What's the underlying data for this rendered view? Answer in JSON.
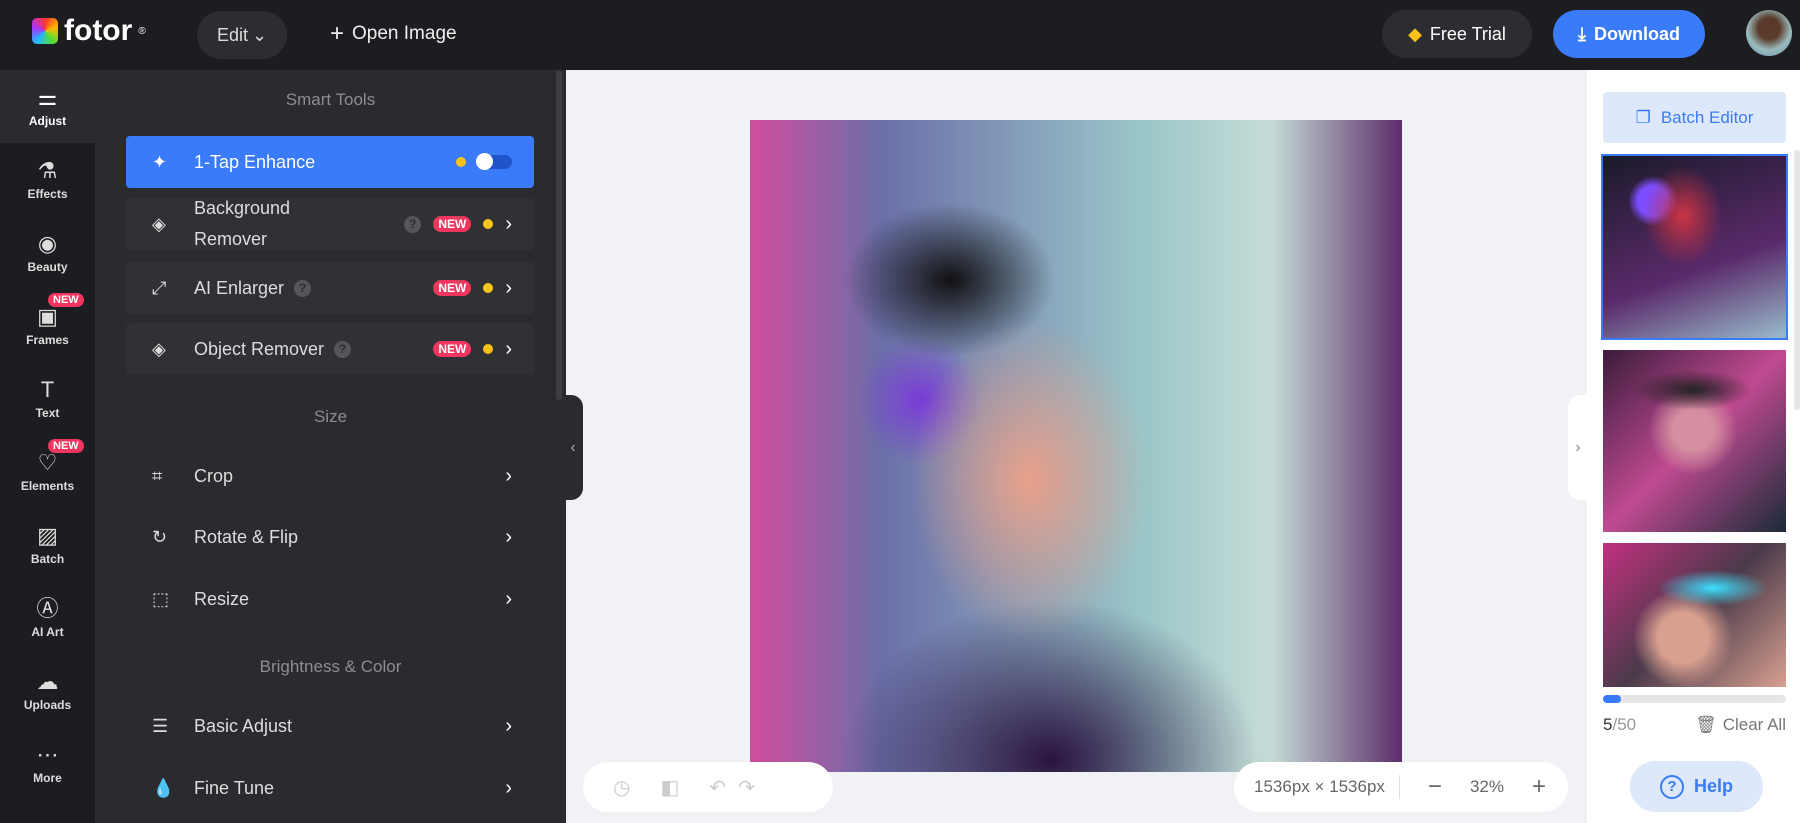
{
  "header": {
    "logo": "fotor",
    "edit_label": "Edit",
    "open_image_label": "Open Image",
    "free_trial_label": "Free Trial",
    "download_label": "Download"
  },
  "rail": [
    {
      "label": "Adjust",
      "icon": "sliders-icon",
      "glyph": "⚌",
      "active": true
    },
    {
      "label": "Effects",
      "icon": "flask-icon",
      "glyph": "⚗"
    },
    {
      "label": "Beauty",
      "icon": "eye-icon",
      "glyph": "◉"
    },
    {
      "label": "Frames",
      "icon": "frame-icon",
      "glyph": "▣",
      "badge": "NEW"
    },
    {
      "label": "Text",
      "icon": "text-icon",
      "glyph": "T"
    },
    {
      "label": "Elements",
      "icon": "shapes-icon",
      "glyph": "♡",
      "badge": "NEW"
    },
    {
      "label": "Batch",
      "icon": "batch-icon",
      "glyph": "▨"
    },
    {
      "label": "AI Art",
      "icon": "ai-icon",
      "glyph": "Ⓐ"
    },
    {
      "label": "Uploads",
      "icon": "upload-icon",
      "glyph": "☁"
    },
    {
      "label": "More",
      "icon": "more-icon",
      "glyph": "⋯"
    }
  ],
  "panel": {
    "sections": [
      "Smart Tools",
      "Size",
      "Brightness & Color"
    ],
    "tools": [
      {
        "label": "1-Tap Enhance",
        "glyph": "✦"
      },
      {
        "label": "Background Remover",
        "glyph": "◈",
        "badge": "NEW"
      },
      {
        "label": "AI Enlarger",
        "glyph": "⤢",
        "badge": "NEW"
      },
      {
        "label": "Object Remover",
        "glyph": "◈",
        "badge": "NEW"
      },
      {
        "label": "Crop",
        "glyph": "⌗"
      },
      {
        "label": "Rotate & Flip",
        "glyph": "↻"
      },
      {
        "label": "Resize",
        "glyph": "⬚"
      },
      {
        "label": "Basic Adjust",
        "glyph": "☰"
      },
      {
        "label": "Fine Tune",
        "glyph": "💧"
      }
    ]
  },
  "canvas": {
    "dimensions": "1536px × 1536px",
    "zoom": "32%"
  },
  "right_panel": {
    "batch_editor_label": "Batch Editor",
    "count_current": "5",
    "count_total": "/50",
    "progress_fraction": 0.1,
    "clear_all_label": "Clear All",
    "help_label": "Help"
  }
}
